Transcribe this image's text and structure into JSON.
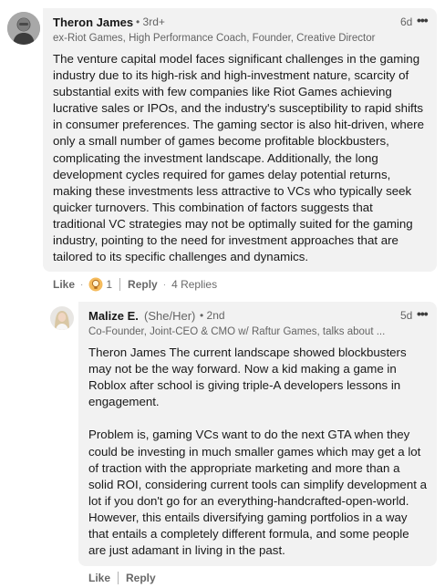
{
  "comment": {
    "author": "Theron James",
    "degree": "• 3rd+",
    "headline": "ex-Riot Games, High Performance Coach, Founder, Creative Director",
    "time": "6d",
    "more_icon": "ellipsis-icon",
    "body_lines": [
      "The venture capital model faces significant challenges in the gaming",
      "industry due to its high-risk and high-investment nature, scarcity of",
      "substantial exits with few companies like Riot Games achieving",
      "lucrative sales or IPOs, and the industry's susceptibility to rapid shifts",
      "in consumer preferences. The gaming sector is also hit-driven, where",
      "only a small number of games become profitable blockbusters,",
      "complicating the investment landscape. Additionally, the long",
      "development cycles required for games delay potential returns,",
      "making these investments less attractive to VCs who typically seek",
      "quicker turnovers. This combination of factors suggests that",
      "traditional VC strategies may not be optimally suited for the gaming",
      "industry, pointing to the need for investment approaches that are",
      "tailored to its specific challenges and dynamics."
    ],
    "actions": {
      "like": "Like",
      "reaction_count": "1",
      "reaction_icon": "insightful-lightbulb-icon",
      "reply": "Reply",
      "replies": "4 Replies"
    }
  },
  "reply": {
    "author": "Malize E.",
    "pronoun": "(She/Her)",
    "degree": "• 2nd",
    "headline": "Co-Founder, Joint-CEO & CMO w/ Raftur Games, talks about ...",
    "time": "5d",
    "more_icon": "ellipsis-icon",
    "para1_lines": [
      "Theron James The current landscape showed blockbusters",
      "may not be the way forward. Now a kid making a game in",
      "Roblox after school is giving triple-A developers lessons in",
      "engagement."
    ],
    "para2_lines": [
      "Problem is, gaming VCs want to do the next GTA when they",
      "could be investing in much smaller games which may get a lot",
      "of traction with the appropriate marketing and more than a",
      "solid ROI, considering current tools can simplify development a",
      "lot if you don't go for an everything-handcrafted-open-world.",
      "However, this entails diversifying gaming portfolios in a way",
      "that entails a completely different formula, and some people",
      "are just adamant in living in the past."
    ],
    "actions": {
      "like": "Like",
      "reply": "Reply"
    }
  },
  "colors": {
    "bubble": "#f2f2f2",
    "text": "#191919",
    "secondary": "#666666"
  }
}
